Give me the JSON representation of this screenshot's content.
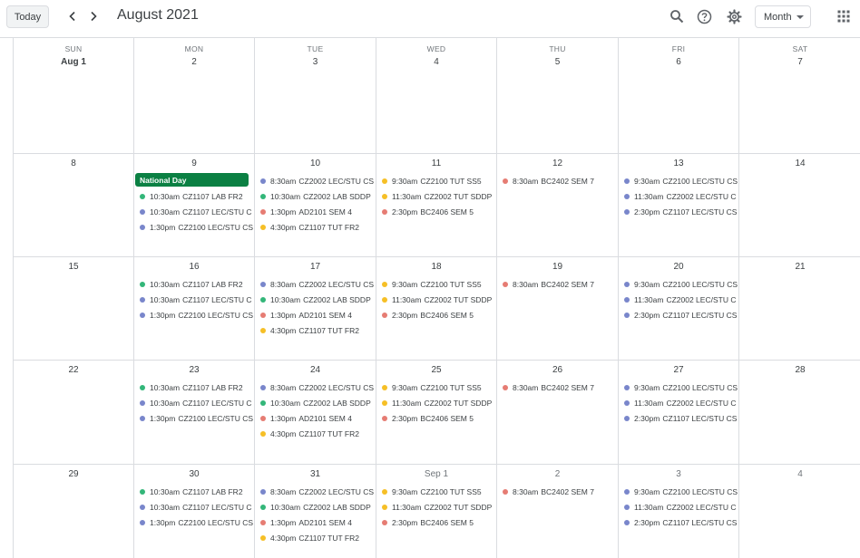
{
  "header": {
    "today_label": "Today",
    "month_title": "August 2021",
    "view_label": "Month",
    "icons": [
      "search-icon",
      "help-icon",
      "settings-icon",
      "apps-icon",
      "chevron-left-icon",
      "chevron-right-icon"
    ]
  },
  "colors": {
    "purple": "#7986cb",
    "green": "#33b679",
    "red": "#e67c73",
    "yellow": "#f6bf26",
    "allday_green": "#0b8043"
  },
  "weekdays": [
    "SUN",
    "MON",
    "TUE",
    "WED",
    "THU",
    "FRI",
    "SAT"
  ],
  "weeks": [
    {
      "days": [
        {
          "date": "Aug 1",
          "bold": true,
          "events": []
        },
        {
          "date": "2",
          "events": []
        },
        {
          "date": "3",
          "events": []
        },
        {
          "date": "4",
          "events": []
        },
        {
          "date": "5",
          "events": []
        },
        {
          "date": "6",
          "events": []
        },
        {
          "date": "7",
          "events": []
        }
      ]
    },
    {
      "days": [
        {
          "date": "8",
          "events": []
        },
        {
          "date": "9",
          "allday": "National Day",
          "events": [
            {
              "time": "10:30am",
              "title": "CZ1107 LAB FR2",
              "color": "green"
            },
            {
              "time": "10:30am",
              "title": "CZ1107 LEC/STU C",
              "color": "purple"
            },
            {
              "time": "1:30pm",
              "title": "CZ2100 LEC/STU CS",
              "color": "purple"
            }
          ]
        },
        {
          "date": "10",
          "events": [
            {
              "time": "8:30am",
              "title": "CZ2002 LEC/STU CS",
              "color": "purple"
            },
            {
              "time": "10:30am",
              "title": "CZ2002 LAB SDDP",
              "color": "green"
            },
            {
              "time": "1:30pm",
              "title": "AD2101 SEM 4",
              "color": "red"
            },
            {
              "time": "4:30pm",
              "title": "CZ1107 TUT FR2",
              "color": "yellow"
            }
          ]
        },
        {
          "date": "11",
          "events": [
            {
              "time": "9:30am",
              "title": "CZ2100 TUT SS5",
              "color": "yellow"
            },
            {
              "time": "11:30am",
              "title": "CZ2002 TUT SDDP",
              "color": "yellow"
            },
            {
              "time": "2:30pm",
              "title": "BC2406 SEM 5",
              "color": "red"
            }
          ]
        },
        {
          "date": "12",
          "events": [
            {
              "time": "8:30am",
              "title": "BC2402 SEM 7",
              "color": "red"
            }
          ]
        },
        {
          "date": "13",
          "events": [
            {
              "time": "9:30am",
              "title": "CZ2100 LEC/STU CS",
              "color": "purple"
            },
            {
              "time": "11:30am",
              "title": "CZ2002 LEC/STU C",
              "color": "purple"
            },
            {
              "time": "2:30pm",
              "title": "CZ1107 LEC/STU CS",
              "color": "purple"
            }
          ]
        },
        {
          "date": "14",
          "events": []
        }
      ]
    },
    {
      "days": [
        {
          "date": "15",
          "events": []
        },
        {
          "date": "16",
          "events": [
            {
              "time": "10:30am",
              "title": "CZ1107 LAB FR2",
              "color": "green"
            },
            {
              "time": "10:30am",
              "title": "CZ1107 LEC/STU C",
              "color": "purple"
            },
            {
              "time": "1:30pm",
              "title": "CZ2100 LEC/STU CS",
              "color": "purple"
            }
          ]
        },
        {
          "date": "17",
          "events": [
            {
              "time": "8:30am",
              "title": "CZ2002 LEC/STU CS",
              "color": "purple"
            },
            {
              "time": "10:30am",
              "title": "CZ2002 LAB SDDP",
              "color": "green"
            },
            {
              "time": "1:30pm",
              "title": "AD2101 SEM 4",
              "color": "red"
            },
            {
              "time": "4:30pm",
              "title": "CZ1107 TUT FR2",
              "color": "yellow"
            }
          ]
        },
        {
          "date": "18",
          "events": [
            {
              "time": "9:30am",
              "title": "CZ2100 TUT SS5",
              "color": "yellow"
            },
            {
              "time": "11:30am",
              "title": "CZ2002 TUT SDDP",
              "color": "yellow"
            },
            {
              "time": "2:30pm",
              "title": "BC2406 SEM 5",
              "color": "red"
            }
          ]
        },
        {
          "date": "19",
          "events": [
            {
              "time": "8:30am",
              "title": "BC2402 SEM 7",
              "color": "red"
            }
          ]
        },
        {
          "date": "20",
          "events": [
            {
              "time": "9:30am",
              "title": "CZ2100 LEC/STU CS",
              "color": "purple"
            },
            {
              "time": "11:30am",
              "title": "CZ2002 LEC/STU C",
              "color": "purple"
            },
            {
              "time": "2:30pm",
              "title": "CZ1107 LEC/STU CS",
              "color": "purple"
            }
          ]
        },
        {
          "date": "21",
          "events": []
        }
      ]
    },
    {
      "days": [
        {
          "date": "22",
          "events": []
        },
        {
          "date": "23",
          "events": [
            {
              "time": "10:30am",
              "title": "CZ1107 LAB FR2",
              "color": "green"
            },
            {
              "time": "10:30am",
              "title": "CZ1107 LEC/STU C",
              "color": "purple"
            },
            {
              "time": "1:30pm",
              "title": "CZ2100 LEC/STU CS",
              "color": "purple"
            }
          ]
        },
        {
          "date": "24",
          "events": [
            {
              "time": "8:30am",
              "title": "CZ2002 LEC/STU CS",
              "color": "purple"
            },
            {
              "time": "10:30am",
              "title": "CZ2002 LAB SDDP",
              "color": "green"
            },
            {
              "time": "1:30pm",
              "title": "AD2101 SEM 4",
              "color": "red"
            },
            {
              "time": "4:30pm",
              "title": "CZ1107 TUT FR2",
              "color": "yellow"
            }
          ]
        },
        {
          "date": "25",
          "events": [
            {
              "time": "9:30am",
              "title": "CZ2100 TUT SS5",
              "color": "yellow"
            },
            {
              "time": "11:30am",
              "title": "CZ2002 TUT SDDP",
              "color": "yellow"
            },
            {
              "time": "2:30pm",
              "title": "BC2406 SEM 5",
              "color": "red"
            }
          ]
        },
        {
          "date": "26",
          "events": [
            {
              "time": "8:30am",
              "title": "BC2402 SEM 7",
              "color": "red"
            }
          ]
        },
        {
          "date": "27",
          "events": [
            {
              "time": "9:30am",
              "title": "CZ2100 LEC/STU CS",
              "color": "purple"
            },
            {
              "time": "11:30am",
              "title": "CZ2002 LEC/STU C",
              "color": "purple"
            },
            {
              "time": "2:30pm",
              "title": "CZ1107 LEC/STU CS",
              "color": "purple"
            }
          ]
        },
        {
          "date": "28",
          "events": []
        }
      ]
    },
    {
      "days": [
        {
          "date": "29",
          "events": []
        },
        {
          "date": "30",
          "events": [
            {
              "time": "10:30am",
              "title": "CZ1107 LAB FR2",
              "color": "green"
            },
            {
              "time": "10:30am",
              "title": "CZ1107 LEC/STU C",
              "color": "purple"
            },
            {
              "time": "1:30pm",
              "title": "CZ2100 LEC/STU CS",
              "color": "purple"
            }
          ]
        },
        {
          "date": "31",
          "events": [
            {
              "time": "8:30am",
              "title": "CZ2002 LEC/STU CS",
              "color": "purple"
            },
            {
              "time": "10:30am",
              "title": "CZ2002 LAB SDDP",
              "color": "green"
            },
            {
              "time": "1:30pm",
              "title": "AD2101 SEM 4",
              "color": "red"
            },
            {
              "time": "4:30pm",
              "title": "CZ1107 TUT FR2",
              "color": "yellow"
            }
          ]
        },
        {
          "date": "Sep 1",
          "grey": true,
          "events": [
            {
              "time": "9:30am",
              "title": "CZ2100 TUT SS5",
              "color": "yellow"
            },
            {
              "time": "11:30am",
              "title": "CZ2002 TUT SDDP",
              "color": "yellow"
            },
            {
              "time": "2:30pm",
              "title": "BC2406 SEM 5",
              "color": "red"
            }
          ]
        },
        {
          "date": "2",
          "grey": true,
          "events": [
            {
              "time": "8:30am",
              "title": "BC2402 SEM 7",
              "color": "red"
            }
          ]
        },
        {
          "date": "3",
          "grey": true,
          "events": [
            {
              "time": "9:30am",
              "title": "CZ2100 LEC/STU CS",
              "color": "purple"
            },
            {
              "time": "11:30am",
              "title": "CZ2002 LEC/STU C",
              "color": "purple"
            },
            {
              "time": "2:30pm",
              "title": "CZ1107 LEC/STU CS",
              "color": "purple"
            }
          ]
        },
        {
          "date": "4",
          "grey": true,
          "events": []
        }
      ]
    }
  ]
}
